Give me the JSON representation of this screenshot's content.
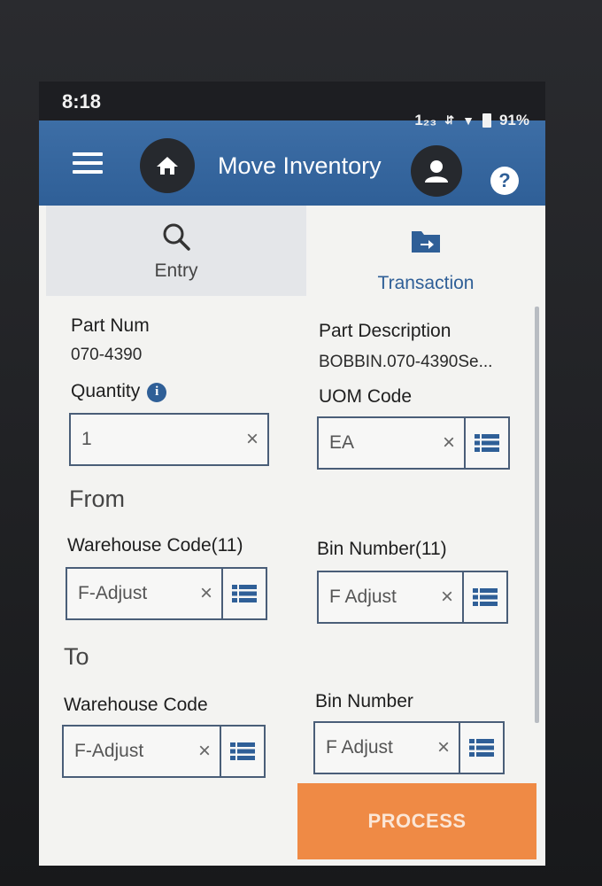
{
  "status_bar": {
    "time": "8:18",
    "network": "1₂₃",
    "battery": "91%"
  },
  "header": {
    "title": "Move Inventory"
  },
  "tabs": [
    {
      "label": "Entry",
      "icon": "search-icon",
      "active": true
    },
    {
      "label": "Transaction",
      "icon": "folder-arrow-icon",
      "active": false
    }
  ],
  "form": {
    "part_num_label": "Part Num",
    "part_num_value": "070-4390",
    "part_desc_label": "Part Description",
    "part_desc_value": "BOBBIN.070-4390Se...",
    "quantity_label": "Quantity",
    "quantity_value": "1",
    "uom_label": "UOM Code",
    "uom_value": "EA",
    "from_heading": "From",
    "from_warehouse_label": "Warehouse Code(11)",
    "from_warehouse_value": "F-Adjust",
    "from_bin_label": "Bin Number(11)",
    "from_bin_value": "F Adjust",
    "to_heading": "To",
    "to_warehouse_label": "Warehouse Code",
    "to_warehouse_value": "F-Adjust",
    "to_bin_label": "Bin Number",
    "to_bin_value": "F Adjust",
    "clear_glyph": "×"
  },
  "actions": {
    "process_label": "PROCESS"
  },
  "colors": {
    "header": "#2f5f97",
    "accent": "#ef8a45",
    "tab_active_text": "#2f5f97"
  }
}
